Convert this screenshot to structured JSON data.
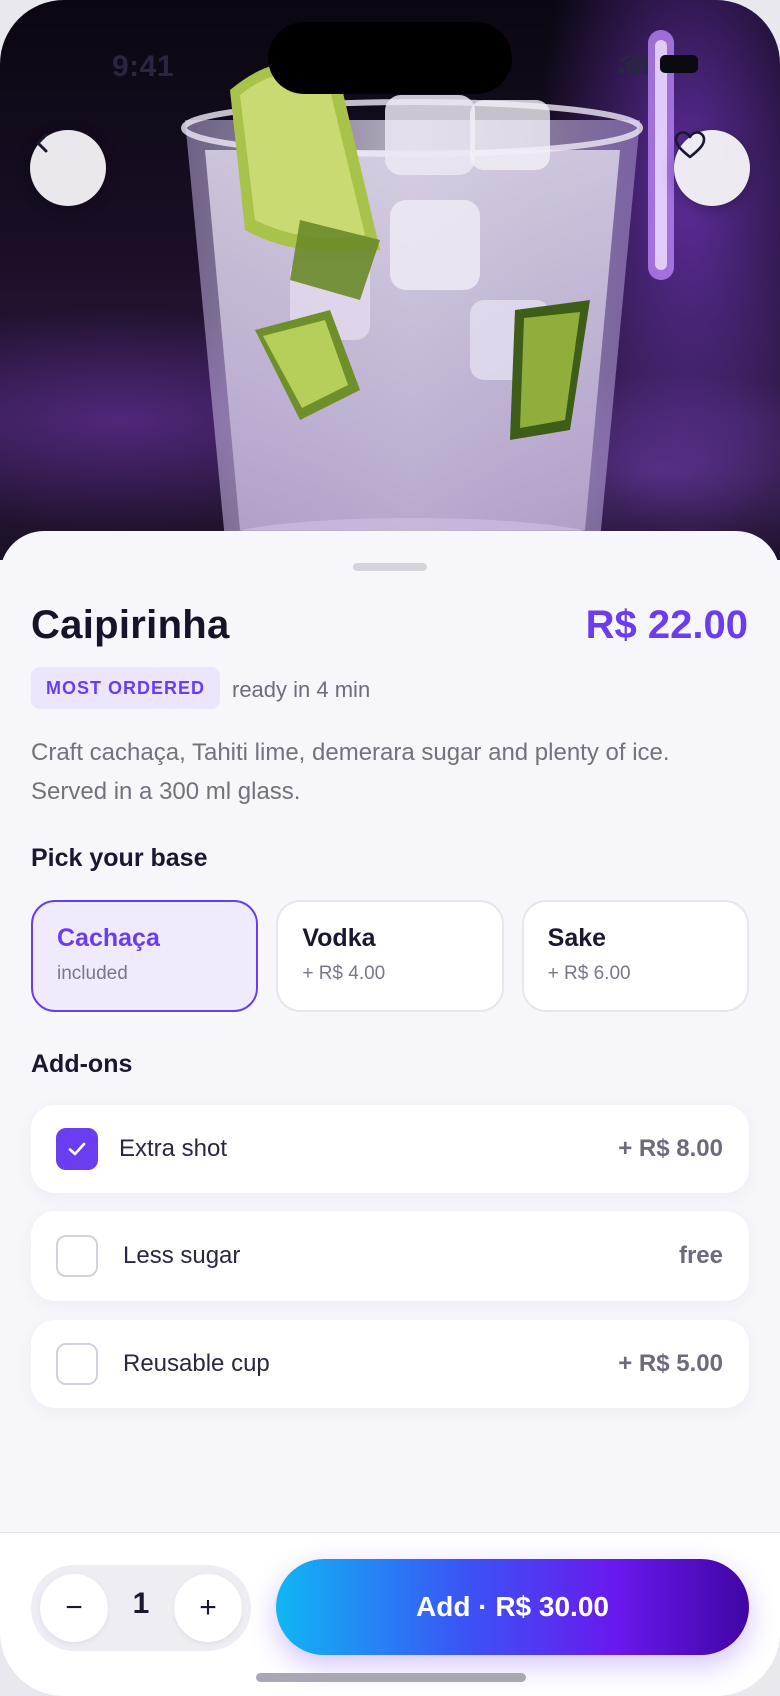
{
  "status_bar": {
    "time": "9:41"
  },
  "product": {
    "name": "Caipirinha",
    "price": "R$ 22.00",
    "badge": "MOST ORDERED",
    "ready_text": "ready in 4 min",
    "description": "Craft cachaça, Tahiti lime, demerara sugar and plenty of ice. Served in a 300 ml glass."
  },
  "base_section": {
    "title": "Pick your base",
    "options": [
      {
        "name": "Cachaça",
        "sub": "included",
        "selected": true
      },
      {
        "name": "Vodka",
        "sub": "+ R$ 4.00",
        "selected": false
      },
      {
        "name": "Sake",
        "sub": "+ R$ 6.00",
        "selected": false
      }
    ]
  },
  "addons_section": {
    "title": "Add-ons",
    "items": [
      {
        "label": "Extra shot",
        "price": "+ R$ 8.00",
        "checked": true
      },
      {
        "label": "Less sugar",
        "price": "free",
        "checked": false
      },
      {
        "label": "Reusable cup",
        "price": "+ R$ 5.00",
        "checked": false
      }
    ]
  },
  "footer": {
    "quantity": "1",
    "minus_label": "−",
    "plus_label": "+",
    "add_button": "Add · R$ 30.00"
  },
  "icons": {
    "back": "chevron-left-icon",
    "favorite": "heart-icon",
    "check": "checkmark-icon"
  },
  "colors": {
    "accent": "#6a3df0",
    "gradient_start": "#10b6f4",
    "gradient_end": "#3f06a4"
  }
}
